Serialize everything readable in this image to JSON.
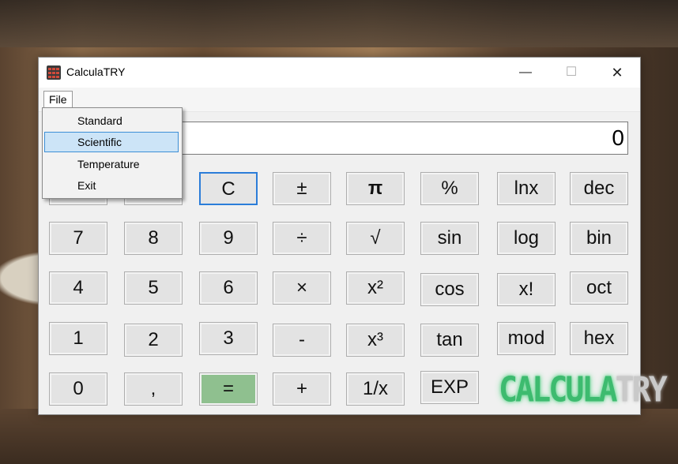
{
  "window": {
    "title": "CalculaTRY",
    "app_icon": "calculator-icon",
    "min_glyph": "—",
    "max_glyph": "☐",
    "close_glyph": "✕"
  },
  "menu": {
    "file_label": "File"
  },
  "file_menu": {
    "items": [
      "Standard",
      "Scientific",
      "Temperature",
      "Exit"
    ],
    "selected": "Scientific"
  },
  "display": {
    "value": "0"
  },
  "keypad": {
    "row1": [
      "",
      "",
      "C",
      "±",
      "π",
      "%",
      "lnx",
      "dec"
    ],
    "row2": [
      "7",
      "8",
      "9",
      "÷",
      "√",
      "sin",
      "log",
      "bin"
    ],
    "row3": [
      "4",
      "5",
      "6",
      "×",
      "x²",
      "cos",
      "x!",
      "oct"
    ],
    "row4": [
      "1",
      "2",
      "3",
      "-",
      "x³",
      "tan",
      "mod",
      "hex"
    ],
    "row5": [
      "0",
      ",",
      "=",
      "+",
      "1/x",
      "EXP"
    ]
  },
  "logo": {
    "part1": "CALCULA",
    "part2": "TRY"
  },
  "colors": {
    "equals": "#8fc08f",
    "focus": "#2b7dd9",
    "menu_highlight": "#cce4f7",
    "logo_green": "#3dbb6f"
  }
}
